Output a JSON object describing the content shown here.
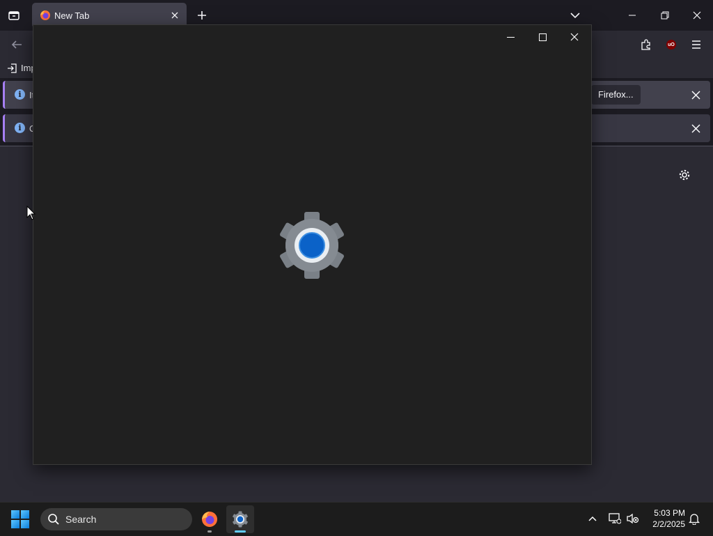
{
  "browser": {
    "tab": {
      "title": "New Tab"
    },
    "bookmarks": {
      "import_label": "Imp"
    },
    "notifications": [
      {
        "message": "It",
        "action_label": "Firefox..."
      },
      {
        "message": "O"
      }
    ]
  },
  "splash": {
    "icon": "settings-gear-icon"
  },
  "taskbar": {
    "search_label": "Search",
    "apps": [
      "firefox",
      "settings"
    ],
    "clock": {
      "time": "5:03 PM",
      "date": "2/2/2025"
    }
  },
  "colors": {
    "accent": "#62cdfe",
    "notification_border": "#a67ff3",
    "splash_bg": "#202020",
    "settings_gear_center": "#0b62c8"
  }
}
